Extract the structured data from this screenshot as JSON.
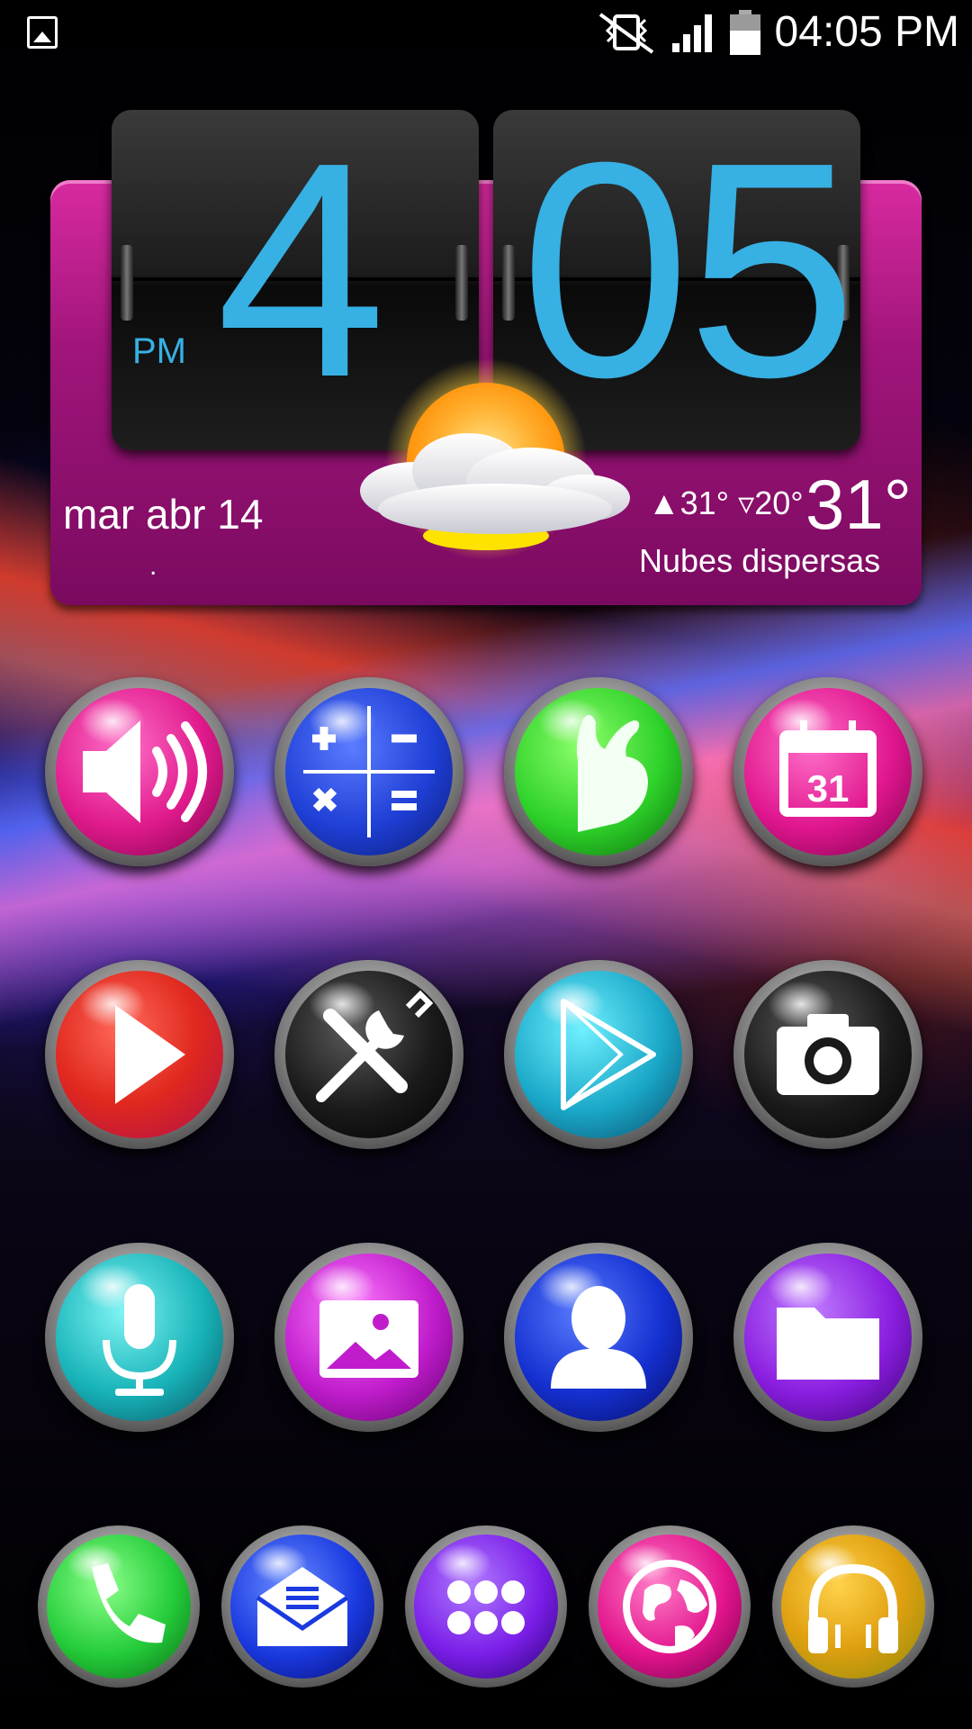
{
  "status_bar": {
    "time": "04:05 PM",
    "icons": [
      "image-notification-icon",
      "vibrate-mute-icon",
      "signal-icon",
      "battery-icon"
    ]
  },
  "clock_widget": {
    "hour": "4",
    "minute": "05",
    "ampm": "PM",
    "date": "mar abr 14",
    "dot": ".",
    "high": "31°",
    "low": "20°",
    "current_temp": "31°",
    "condition": "Nubes dispersas",
    "weather_icon": "partly-cloudy-sun-icon",
    "accent_color": "#37b0e3",
    "frame_color": "#b0187f"
  },
  "apps": [
    {
      "name": "volume",
      "icon": "speaker-icon",
      "color": "#e01a8c"
    },
    {
      "name": "calculator",
      "icon": "calculator-icon",
      "color": "#1f3fd6",
      "labels": [
        "+",
        "−",
        "×",
        "="
      ]
    },
    {
      "name": "gesture",
      "icon": "ok-hand-icon",
      "color": "#2ed12a"
    },
    {
      "name": "calendar",
      "icon": "calendar-icon",
      "color": "#e0168e",
      "day": "31"
    },
    {
      "name": "video-player",
      "icon": "play-icon",
      "color": "#e0281e"
    },
    {
      "name": "settings",
      "icon": "tools-icon",
      "color": "#1a1a1a"
    },
    {
      "name": "play-store",
      "icon": "play-store-icon",
      "color": "#1aa8c8"
    },
    {
      "name": "camera",
      "icon": "camera-icon",
      "color": "#1a1a1a"
    },
    {
      "name": "voice-recorder",
      "icon": "microphone-icon",
      "color": "#17b3b8"
    },
    {
      "name": "gallery",
      "icon": "picture-icon",
      "color": "#c01ccc"
    },
    {
      "name": "contacts",
      "icon": "contact-icon",
      "color": "#1430d0"
    },
    {
      "name": "files",
      "icon": "folder-icon",
      "color": "#8a1ee0"
    }
  ],
  "dock": [
    {
      "name": "phone",
      "icon": "phone-icon",
      "color": "#24cc3a"
    },
    {
      "name": "email",
      "icon": "email-icon",
      "color": "#1a3ae0"
    },
    {
      "name": "app-drawer",
      "icon": "apps-grid-icon",
      "color": "#7a1ee8"
    },
    {
      "name": "browser",
      "icon": "globe-icon",
      "color": "#e2148c"
    },
    {
      "name": "music",
      "icon": "headphones-icon",
      "color": "#e0a010"
    }
  ]
}
